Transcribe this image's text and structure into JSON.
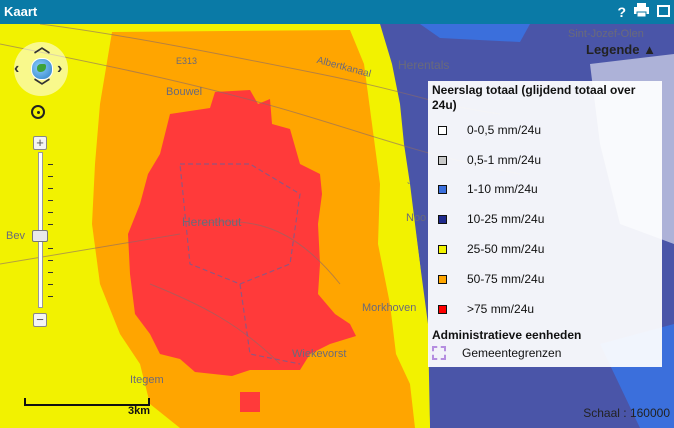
{
  "window": {
    "title": "Kaart"
  },
  "toolbar": {
    "help_icon": "?",
    "print_icon": "printer-icon",
    "window_icon": "maximize-icon"
  },
  "map": {
    "places": [
      "Sint-Jozef-Olen",
      "Herentals",
      "Bouwel",
      "Herenthout",
      "Bev",
      "Noo",
      "Morkhoven",
      "Wiekevorst",
      "Itegem",
      "E313",
      "Albertkanaal"
    ],
    "scale_bar_label": "3km",
    "scale_text": "Schaal : 160000"
  },
  "legend": {
    "header": "Legende ▲",
    "layer_title": "Neerslag totaal (glijdend totaal over 24u)",
    "items": [
      {
        "label": "0-0,5 mm/24u",
        "color": "#ffffff"
      },
      {
        "label": "0,5-1 mm/24u",
        "color": "#c8c8c8"
      },
      {
        "label": "1-10 mm/24u",
        "color": "#3b6fdc"
      },
      {
        "label": "10-25 mm/24u",
        "color": "#1f2a8c"
      },
      {
        "label": "25-50 mm/24u",
        "color": "#f2f200"
      },
      {
        "label": "50-75 mm/24u",
        "color": "#ffa500"
      },
      {
        "label": ">75 mm/24u",
        "color": "#ff0000"
      }
    ],
    "admin_title": "Administratieve eenheden",
    "admin_item": "Gemeentegrenzen"
  },
  "colors": {
    "titlebar": "#0a7aa6",
    "yellow": "#f2f200",
    "orange": "#ffa500",
    "red": "#ff3a3a",
    "blue": "#4a55a8"
  }
}
